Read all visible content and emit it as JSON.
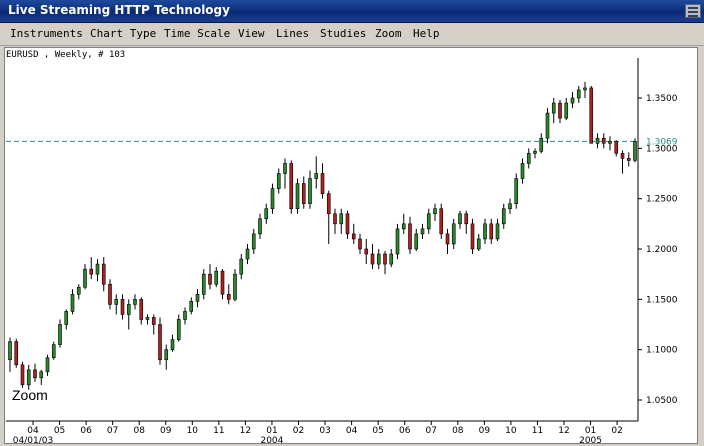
{
  "window": {
    "title": "Live Streaming HTTP Technology"
  },
  "menu": [
    "Instruments",
    "Chart Type",
    "Time Scale",
    "View",
    "Lines",
    "Studies",
    "Zoom",
    "Help"
  ],
  "chart_header": {
    "symbol_info": "EURUSD , Weekly, # 103"
  },
  "zoom_label": "Zoom",
  "colors": {
    "up": "#2a8a2a",
    "down": "#b02020",
    "reference_line": "#2a8c8c",
    "title_bg": "#0a2a78"
  },
  "chart_data": {
    "type": "candlestick",
    "price_axis": {
      "ticks": [
        {
          "value": 1.05,
          "label": "1.0500"
        },
        {
          "value": 1.1,
          "label": "1.1000"
        },
        {
          "value": 1.15,
          "label": "1.1500"
        },
        {
          "value": 1.2,
          "label": "1.2000"
        },
        {
          "value": 1.25,
          "label": "1.2500"
        },
        {
          "value": 1.3,
          "label": "1.3000"
        },
        {
          "value": 1.35,
          "label": "1.3500"
        }
      ],
      "range": [
        1.035,
        1.365
      ]
    },
    "reference_line": {
      "value": 1.3069,
      "label": "1.3069"
    },
    "month_ticks": [
      "04",
      "05",
      "06",
      "07",
      "08",
      "09",
      "10",
      "11",
      "12",
      "01",
      "02",
      "03",
      "04",
      "05",
      "06",
      "07",
      "08",
      "09",
      "10",
      "11",
      "12",
      "01",
      "02"
    ],
    "date_labels": [
      {
        "label": "04/01/03",
        "month_index": 0
      },
      {
        "label": "2004",
        "month_index": 9
      },
      {
        "label": "2005",
        "month_index": 21
      }
    ],
    "candles": [
      [
        1.09,
        1.112,
        1.078,
        1.108
      ],
      [
        1.108,
        1.111,
        1.082,
        1.085
      ],
      [
        1.085,
        1.088,
        1.062,
        1.065
      ],
      [
        1.065,
        1.085,
        1.06,
        1.08
      ],
      [
        1.08,
        1.086,
        1.068,
        1.072
      ],
      [
        1.072,
        1.08,
        1.065,
        1.078
      ],
      [
        1.078,
        1.095,
        1.074,
        1.092
      ],
      [
        1.092,
        1.108,
        1.09,
        1.105
      ],
      [
        1.105,
        1.13,
        1.102,
        1.125
      ],
      [
        1.125,
        1.14,
        1.12,
        1.138
      ],
      [
        1.138,
        1.16,
        1.135,
        1.155
      ],
      [
        1.155,
        1.165,
        1.15,
        1.162
      ],
      [
        1.162,
        1.185,
        1.16,
        1.18
      ],
      [
        1.18,
        1.192,
        1.17,
        1.175
      ],
      [
        1.175,
        1.19,
        1.168,
        1.185
      ],
      [
        1.185,
        1.192,
        1.158,
        1.165
      ],
      [
        1.165,
        1.17,
        1.14,
        1.145
      ],
      [
        1.145,
        1.155,
        1.135,
        1.15
      ],
      [
        1.15,
        1.155,
        1.13,
        1.135
      ],
      [
        1.135,
        1.15,
        1.12,
        1.145
      ],
      [
        1.145,
        1.155,
        1.14,
        1.15
      ],
      [
        1.15,
        1.152,
        1.125,
        1.13
      ],
      [
        1.13,
        1.135,
        1.125,
        1.132
      ],
      [
        1.132,
        1.135,
        1.115,
        1.125
      ],
      [
        1.125,
        1.132,
        1.085,
        1.09
      ],
      [
        1.09,
        1.105,
        1.08,
        1.1
      ],
      [
        1.1,
        1.115,
        1.098,
        1.11
      ],
      [
        1.11,
        1.135,
        1.108,
        1.13
      ],
      [
        1.13,
        1.142,
        1.125,
        1.138
      ],
      [
        1.138,
        1.152,
        1.135,
        1.148
      ],
      [
        1.148,
        1.16,
        1.142,
        1.155
      ],
      [
        1.155,
        1.18,
        1.15,
        1.175
      ],
      [
        1.175,
        1.185,
        1.16,
        1.165
      ],
      [
        1.165,
        1.182,
        1.162,
        1.178
      ],
      [
        1.178,
        1.18,
        1.15,
        1.155
      ],
      [
        1.155,
        1.165,
        1.145,
        1.15
      ],
      [
        1.15,
        1.18,
        1.148,
        1.175
      ],
      [
        1.175,
        1.195,
        1.17,
        1.19
      ],
      [
        1.19,
        1.205,
        1.185,
        1.2
      ],
      [
        1.2,
        1.22,
        1.195,
        1.215
      ],
      [
        1.215,
        1.235,
        1.21,
        1.23
      ],
      [
        1.23,
        1.245,
        1.225,
        1.24
      ],
      [
        1.24,
        1.265,
        1.235,
        1.26
      ],
      [
        1.26,
        1.28,
        1.255,
        1.275
      ],
      [
        1.275,
        1.29,
        1.26,
        1.285
      ],
      [
        1.285,
        1.288,
        1.235,
        1.24
      ],
      [
        1.24,
        1.27,
        1.235,
        1.265
      ],
      [
        1.265,
        1.272,
        1.24,
        1.245
      ],
      [
        1.245,
        1.278,
        1.24,
        1.27
      ],
      [
        1.27,
        1.292,
        1.26,
        1.275
      ],
      [
        1.275,
        1.285,
        1.25,
        1.255
      ],
      [
        1.255,
        1.258,
        1.205,
        1.235
      ],
      [
        1.235,
        1.24,
        1.215,
        1.225
      ],
      [
        1.225,
        1.24,
        1.215,
        1.235
      ],
      [
        1.235,
        1.238,
        1.21,
        1.215
      ],
      [
        1.215,
        1.225,
        1.205,
        1.21
      ],
      [
        1.21,
        1.215,
        1.195,
        1.2
      ],
      [
        1.2,
        1.21,
        1.185,
        1.195
      ],
      [
        1.195,
        1.205,
        1.18,
        1.185
      ],
      [
        1.185,
        1.2,
        1.18,
        1.195
      ],
      [
        1.195,
        1.198,
        1.175,
        1.185
      ],
      [
        1.185,
        1.2,
        1.182,
        1.195
      ],
      [
        1.195,
        1.225,
        1.19,
        1.22
      ],
      [
        1.22,
        1.235,
        1.215,
        1.225
      ],
      [
        1.225,
        1.232,
        1.195,
        1.2
      ],
      [
        1.2,
        1.22,
        1.198,
        1.215
      ],
      [
        1.215,
        1.225,
        1.21,
        1.22
      ],
      [
        1.22,
        1.24,
        1.215,
        1.235
      ],
      [
        1.235,
        1.245,
        1.228,
        1.24
      ],
      [
        1.24,
        1.245,
        1.21,
        1.215
      ],
      [
        1.215,
        1.22,
        1.195,
        1.205
      ],
      [
        1.205,
        1.23,
        1.2,
        1.225
      ],
      [
        1.225,
        1.238,
        1.22,
        1.235
      ],
      [
        1.235,
        1.238,
        1.215,
        1.225
      ],
      [
        1.225,
        1.23,
        1.195,
        1.2
      ],
      [
        1.2,
        1.215,
        1.198,
        1.21
      ],
      [
        1.21,
        1.23,
        1.205,
        1.225
      ],
      [
        1.225,
        1.23,
        1.205,
        1.21
      ],
      [
        1.21,
        1.23,
        1.208,
        1.225
      ],
      [
        1.225,
        1.245,
        1.22,
        1.24
      ],
      [
        1.24,
        1.25,
        1.235,
        1.245
      ],
      [
        1.245,
        1.275,
        1.24,
        1.27
      ],
      [
        1.27,
        1.29,
        1.265,
        1.285
      ],
      [
        1.285,
        1.3,
        1.28,
        1.295
      ],
      [
        1.295,
        1.3,
        1.29,
        1.297
      ],
      [
        1.297,
        1.315,
        1.295,
        1.31
      ],
      [
        1.31,
        1.34,
        1.305,
        1.335
      ],
      [
        1.335,
        1.35,
        1.325,
        1.345
      ],
      [
        1.345,
        1.348,
        1.325,
        1.33
      ],
      [
        1.33,
        1.35,
        1.328,
        1.345
      ],
      [
        1.345,
        1.356,
        1.34,
        1.35
      ],
      [
        1.35,
        1.362,
        1.345,
        1.358
      ],
      [
        1.358,
        1.366,
        1.35,
        1.36
      ],
      [
        1.36,
        1.362,
        1.305,
        1.305
      ],
      [
        1.305,
        1.315,
        1.3,
        1.31
      ],
      [
        1.31,
        1.315,
        1.3,
        1.305
      ],
      [
        1.305,
        1.312,
        1.298,
        1.307
      ],
      [
        1.307,
        1.308,
        1.292,
        1.295
      ],
      [
        1.295,
        1.298,
        1.275,
        1.29
      ],
      [
        1.29,
        1.296,
        1.282,
        1.288
      ],
      [
        1.288,
        1.31,
        1.286,
        1.3069
      ]
    ]
  }
}
